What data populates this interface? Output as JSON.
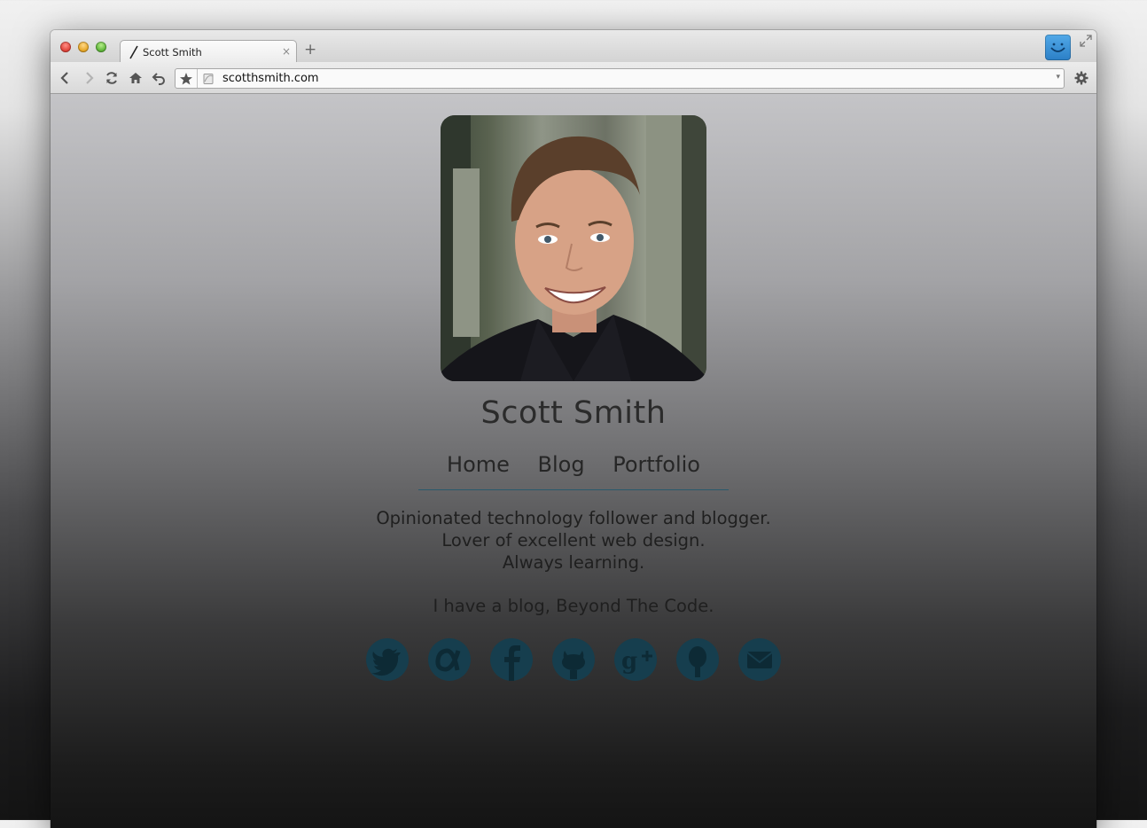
{
  "browser": {
    "tab_title": "Scott Smith",
    "new_tab_symbol": "+",
    "tab_close_symbol": "×",
    "url": "scotthsmith.com",
    "address_dropdown_symbol": "▾"
  },
  "page": {
    "name": "Scott Smith",
    "nav": [
      "Home",
      "Blog",
      "Portfolio"
    ],
    "bio_lines": [
      "Opinionated technology follower and blogger.",
      "Lover of excellent web design.",
      "Always learning."
    ],
    "blog_line": "I have a blog, Beyond The Code.",
    "social_icons": [
      "twitter-icon",
      "app-net-icon",
      "facebook-icon",
      "github-icon",
      "google-plus-icon",
      "quora-icon",
      "email-icon"
    ]
  },
  "colors": {
    "social_icon_bg": "#163e4e",
    "nav_rule": "#2a5a6c",
    "text": "#2b2b2b"
  }
}
